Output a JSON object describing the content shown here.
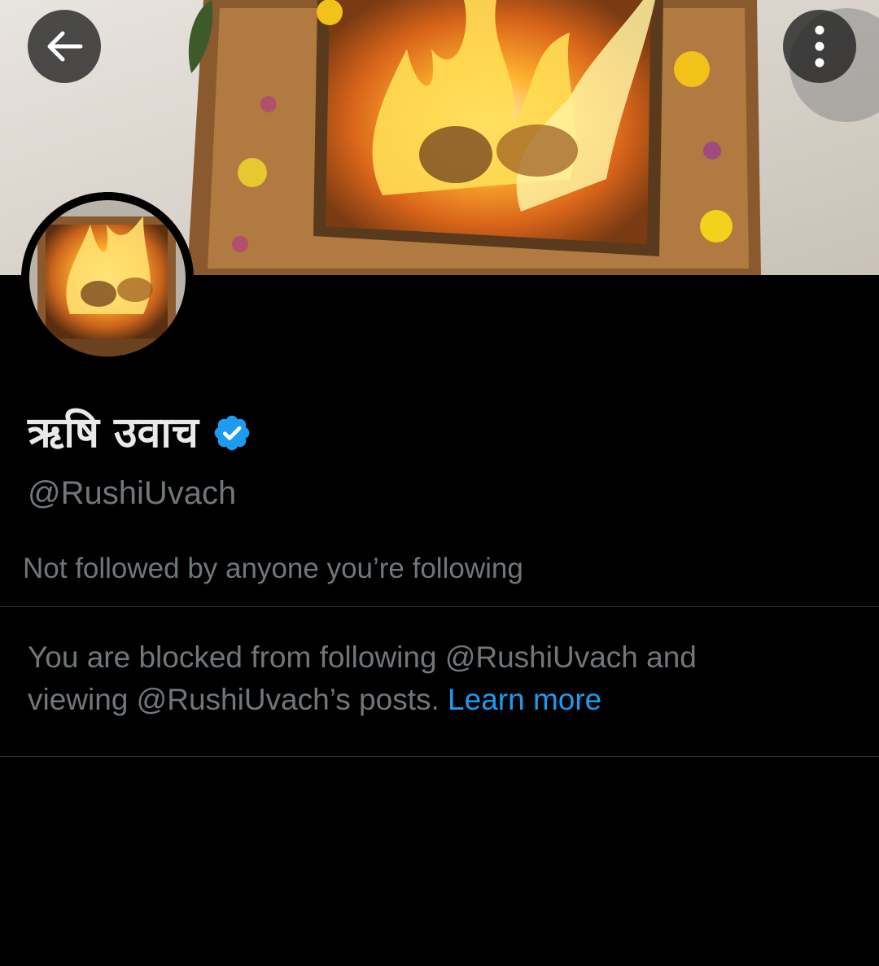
{
  "header": {
    "back_icon": "arrow-left-icon",
    "more_icon": "more-vertical-icon"
  },
  "banner": {
    "description_icon": "fire-ritual-banner"
  },
  "profile": {
    "display_name": "ऋषि उवाच",
    "verified": true,
    "verified_color": "#1d9bf0",
    "handle": "@RushiUvach",
    "followers_note": "Not followed by anyone you’re following"
  },
  "blocked_notice": {
    "text_line_1": "You are blocked from following @RushiUvach and",
    "text_line_2": "viewing @RushiUvach’s posts.",
    "link_label": "Learn more",
    "link_color": "#1d9bf0"
  },
  "colors": {
    "background": "#000000",
    "primary_text": "#e7e9ea",
    "secondary_text": "#71767b",
    "divider": "#2f3336"
  }
}
